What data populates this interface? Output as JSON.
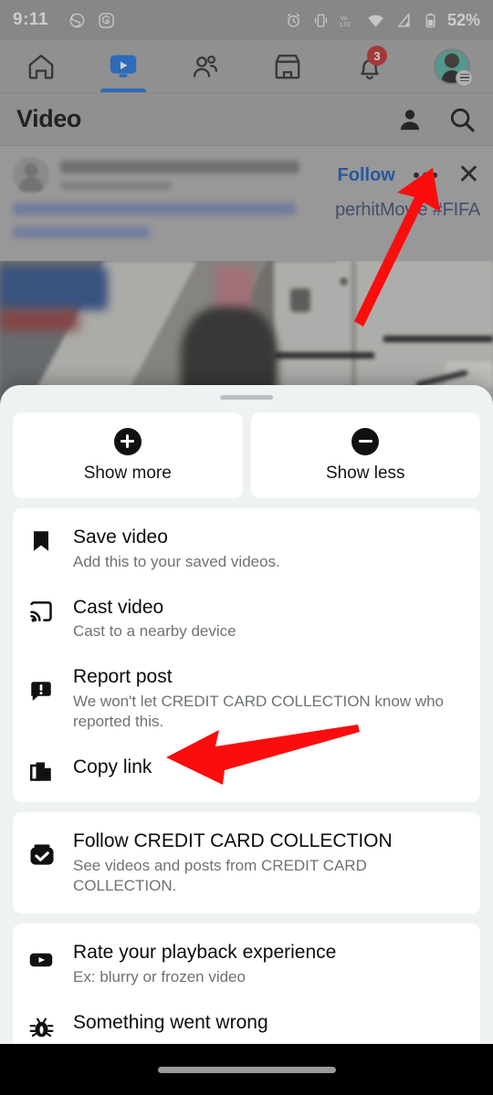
{
  "status_bar": {
    "time": "9:11",
    "battery_percent": "52%",
    "left_icons": [
      "app-glyph-icon",
      "app-spiral-icon"
    ],
    "right_icons": [
      "alarm-icon",
      "vibrate-icon",
      "volte-icon",
      "wifi-icon",
      "signal-icon",
      "battery-icon"
    ]
  },
  "top_nav": {
    "tabs": [
      {
        "name": "home",
        "icon": "home-icon",
        "active": false
      },
      {
        "name": "video",
        "icon": "video-icon",
        "active": true
      },
      {
        "name": "friends",
        "icon": "friends-icon",
        "active": false
      },
      {
        "name": "marketplace",
        "icon": "marketplace-icon",
        "active": false
      },
      {
        "name": "notifications",
        "icon": "bell-icon",
        "active": false,
        "badge": "3"
      },
      {
        "name": "menu",
        "icon": "avatar-icon",
        "active": false
      }
    ],
    "accent_color": "#1b74e4",
    "badge_color": "#c42b2b"
  },
  "video_header": {
    "title": "Video",
    "actions": [
      "person-icon",
      "search-icon"
    ]
  },
  "post": {
    "author_blurred": true,
    "follow_label": "Follow",
    "separator": "·",
    "menu_icon": "more-options-icon",
    "close_icon": "close-icon",
    "caption_visible_tail": "perhitMovie #FIFA"
  },
  "sheet": {
    "quick_actions": [
      {
        "icon": "plus-circle-icon",
        "label": "Show more"
      },
      {
        "icon": "minus-circle-icon",
        "label": "Show less"
      }
    ],
    "groups": [
      {
        "name": "primary-actions",
        "items": [
          {
            "icon": "bookmark-icon",
            "title": "Save video",
            "sub": "Add this to your saved videos."
          },
          {
            "icon": "cast-icon",
            "title": "Cast video",
            "sub": "Cast to a nearby device"
          },
          {
            "icon": "report-icon",
            "title": "Report post",
            "sub": "We won't let CREDIT CARD COLLECTION know who reported this."
          },
          {
            "icon": "copy-link-icon",
            "title": "Copy link",
            "sub": ""
          }
        ]
      },
      {
        "name": "follow-group",
        "items": [
          {
            "icon": "follow-check-icon",
            "title": "Follow CREDIT CARD COLLECTION",
            "sub": "See videos and posts from CREDIT CARD COLLECTION."
          }
        ]
      },
      {
        "name": "feedback-group",
        "items": [
          {
            "icon": "play-icon",
            "title": "Rate your playback experience",
            "sub": "Ex: blurry or frozen video"
          },
          {
            "icon": "bug-icon",
            "title": "Something went wrong",
            "sub": ""
          }
        ]
      }
    ],
    "background_color": "#eef2f3",
    "card_color": "#ffffff"
  },
  "annotations": {
    "arrow_color": "#fb0d0d",
    "arrows": [
      {
        "name": "arrow-to-more-options",
        "points_to": "post-more-options-button"
      },
      {
        "name": "arrow-to-copy-link",
        "points_to": "copy-link-row"
      }
    ]
  },
  "nav_bar": {
    "home_indicator": "home-indicator"
  }
}
